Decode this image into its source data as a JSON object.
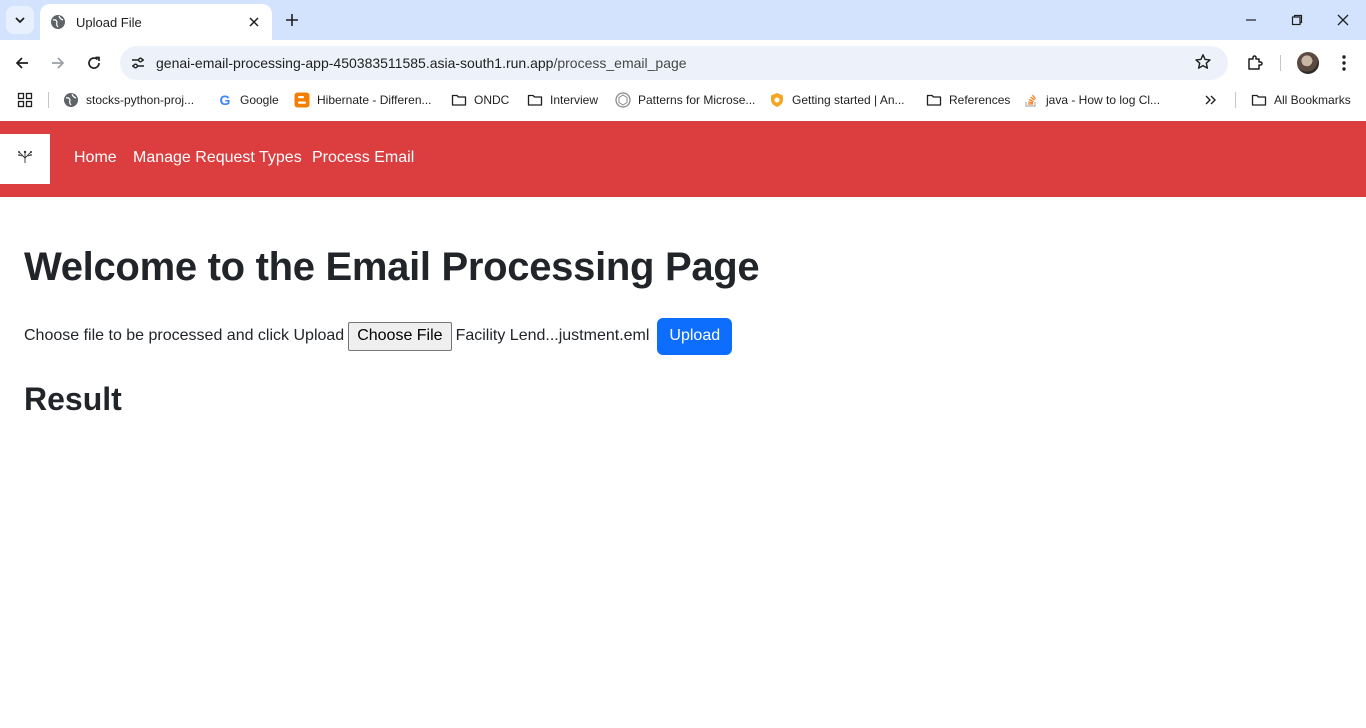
{
  "browser": {
    "tab": {
      "title": "Upload File"
    },
    "url": {
      "host": "genai-email-processing-app-450383511585.asia-south1.run.app",
      "path": "/process_email_page"
    },
    "bookmarks": [
      {
        "label": "stocks-python-proj...",
        "icon": "globe-icon"
      },
      {
        "label": "Google",
        "icon": "google-icon"
      },
      {
        "label": "Hibernate - Differen...",
        "icon": "blogger-icon"
      },
      {
        "label": "ONDC",
        "icon": "folder-icon"
      },
      {
        "label": "Interview",
        "icon": "folder-icon"
      },
      {
        "label": "Patterns for Microse...",
        "icon": "hexagon-icon"
      },
      {
        "label": "Getting started | An...",
        "icon": "shield-icon"
      },
      {
        "label": "References",
        "icon": "folder-icon"
      },
      {
        "label": "java - How to log Cl...",
        "icon": "stackoverflow-icon"
      }
    ],
    "all_bookmarks_label": "All Bookmarks"
  },
  "nav": {
    "links": [
      "Home",
      "Manage Request Types",
      "Process Email"
    ]
  },
  "main": {
    "heading": "Welcome to the Email Processing Page",
    "choose_label": "Choose file to be processed and click Upload",
    "choose_button": "Choose File",
    "file_name": "Facility Lend...justment.eml",
    "upload_button": "Upload",
    "result_heading": "Result"
  },
  "colors": {
    "navbar": "#dc3d3f",
    "upload_button": "#0d6efd",
    "tabstrip": "#d3e3fd"
  }
}
